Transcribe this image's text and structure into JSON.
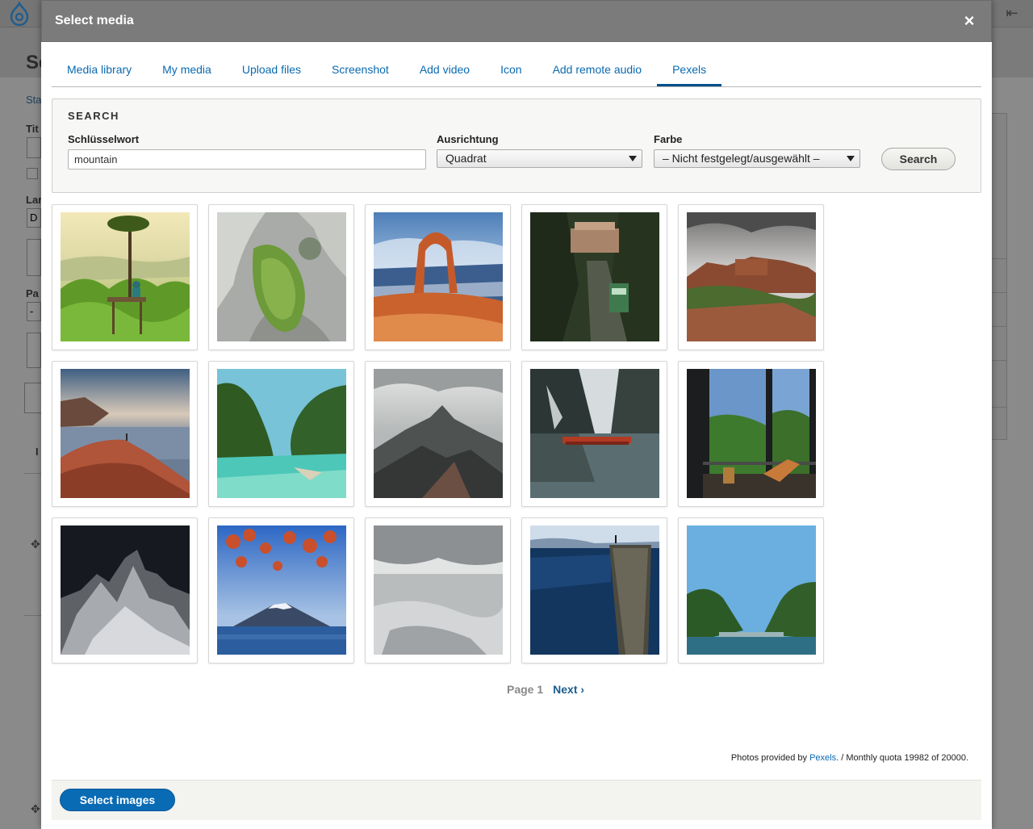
{
  "background": {
    "page_title_fragment": "Se",
    "left_labels": [
      "Sta",
      "Tit",
      "Lar",
      "D",
      "Pa",
      "-",
      "I"
    ]
  },
  "dialog": {
    "title": "Select media",
    "close_glyph": "×"
  },
  "tabs": [
    {
      "label": "Media library",
      "active": false
    },
    {
      "label": "My media",
      "active": false
    },
    {
      "label": "Upload files",
      "active": false
    },
    {
      "label": "Screenshot",
      "active": false
    },
    {
      "label": "Add video",
      "active": false
    },
    {
      "label": "Icon",
      "active": false
    },
    {
      "label": "Add remote audio",
      "active": false
    },
    {
      "label": "Pexels",
      "active": true
    }
  ],
  "search": {
    "legend": "SEARCH",
    "keyword_label": "Schlüsselwort",
    "keyword_value": "mountain",
    "orientation_label": "Ausrichtung",
    "orientation_value": "Quadrat",
    "color_label": "Farbe",
    "color_value": "– Nicht festgelegt/ausgewählt –",
    "button_label": "Search"
  },
  "results": [
    {
      "subject": "tree-platform-valley"
    },
    {
      "subject": "aerial-rock-lagoon"
    },
    {
      "subject": "arch-rock-desert"
    },
    {
      "subject": "mountain-train-monastery"
    },
    {
      "subject": "kasbah-fortress"
    },
    {
      "subject": "cliff-hiker-sunset"
    },
    {
      "subject": "lagoon-boat-cliffs"
    },
    {
      "subject": "misty-mountain-peaks"
    },
    {
      "subject": "lake-reflection-boats"
    },
    {
      "subject": "balcony-forest-view"
    },
    {
      "subject": "snowy-mountain-night"
    },
    {
      "subject": "fuji-maple-leaves"
    },
    {
      "subject": "aerial-snow-terrain"
    },
    {
      "subject": "preikestolen-cliff"
    },
    {
      "subject": "bay-cliffs-blue-sky"
    }
  ],
  "pager": {
    "current": "Page 1",
    "next": "Next ›"
  },
  "credit": {
    "prefix": "Photos provided by ",
    "link": "Pexels",
    "suffix": ". / Monthly quota 19982 of 20000."
  },
  "footer": {
    "select_button": "Select images"
  },
  "colors": {
    "accent": "#0a6bb5",
    "link": "#0a6ab0",
    "titlebar": "#7b7b7b"
  }
}
